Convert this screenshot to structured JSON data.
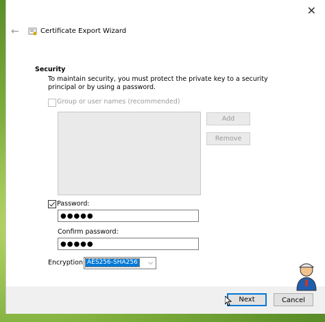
{
  "window": {
    "close_icon": "close-icon",
    "back_icon": "back-arrow-icon",
    "title": "Certificate Export Wizard"
  },
  "security": {
    "title": "Security",
    "description": "To maintain security, you must protect the private key to a security principal or by using a password.",
    "group_checkbox": {
      "label": "Group or user names (recommended)",
      "checked": false,
      "enabled": false
    },
    "add_label": "Add",
    "remove_label": "Remove",
    "password_checkbox": {
      "label": "Password:",
      "checked": true
    },
    "password_value": "●●●●●",
    "confirm_label": "Confirm password:",
    "confirm_value": "●●●●●",
    "encryption_label": "Encryption:",
    "encryption_value": "AES256-SHA256"
  },
  "footer": {
    "next_label": "Next",
    "cancel_label": "Cancel"
  },
  "colors": {
    "accent": "#0078d7",
    "desktop_green": "#7fae3c"
  }
}
